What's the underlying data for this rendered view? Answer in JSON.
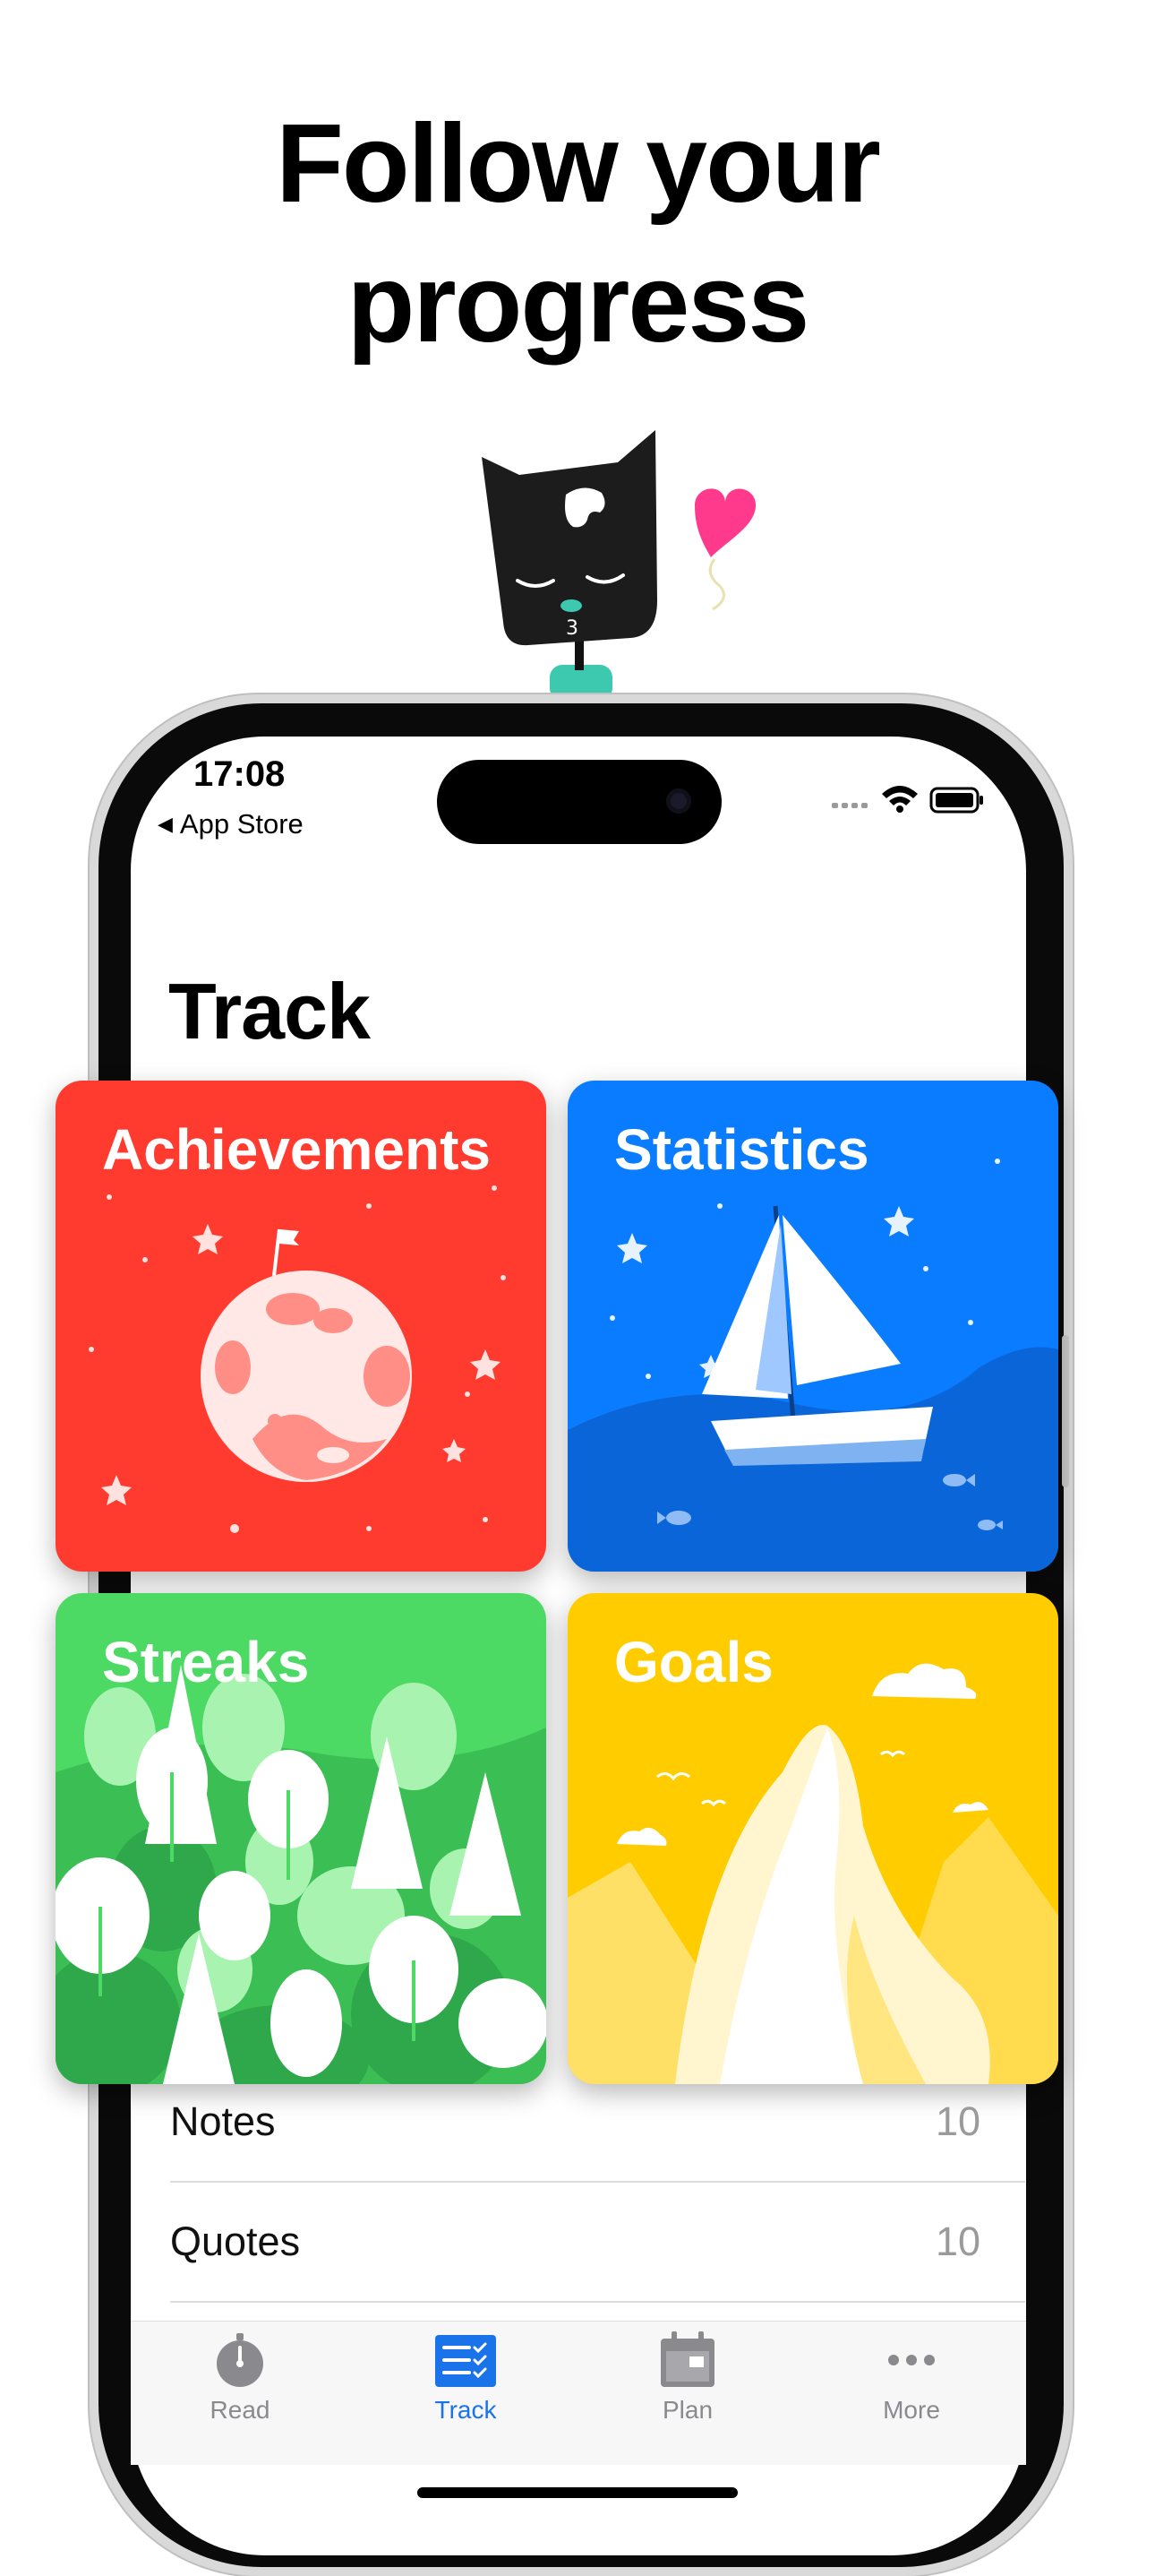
{
  "headline": {
    "line1": "Follow your",
    "line2": "progress"
  },
  "status_bar": {
    "time": "17:08",
    "back_label": "App Store"
  },
  "page_title": "Track",
  "cards": [
    {
      "id": "achievements",
      "label": "Achievements",
      "color": "#ff3b30"
    },
    {
      "id": "statistics",
      "label": "Statistics",
      "color": "#0a7cff"
    },
    {
      "id": "streaks",
      "label": "Streaks",
      "color": "#4cd964"
    },
    {
      "id": "goals",
      "label": "Goals",
      "color": "#ffcc00"
    }
  ],
  "list": [
    {
      "label": "Notes",
      "value": "10"
    },
    {
      "label": "Quotes",
      "value": "10"
    }
  ],
  "tabs": [
    {
      "label": "Read",
      "icon": "stopwatch-icon",
      "active": false
    },
    {
      "label": "Track",
      "icon": "checklist-icon",
      "active": true
    },
    {
      "label": "Plan",
      "icon": "calendar-icon",
      "active": false
    },
    {
      "label": "More",
      "icon": "ellipsis-icon",
      "active": false
    }
  ],
  "colors": {
    "accent": "#1a73e8",
    "heart": "#ff3a8c"
  }
}
